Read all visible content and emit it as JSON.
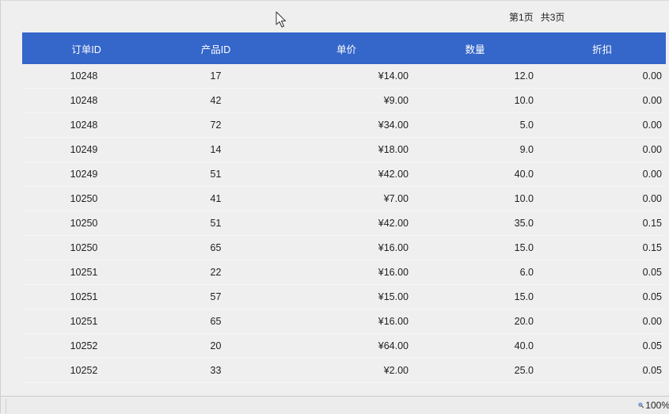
{
  "pagination": {
    "current": "第1页",
    "total": "共3页"
  },
  "table": {
    "columns": [
      "订单ID",
      "产品ID",
      "单价",
      "数量",
      "折扣"
    ],
    "rows": [
      [
        "10248",
        "17",
        "¥14.00",
        "12.0",
        "0.00"
      ],
      [
        "10248",
        "42",
        "¥9.00",
        "10.0",
        "0.00"
      ],
      [
        "10248",
        "72",
        "¥34.00",
        "5.0",
        "0.00"
      ],
      [
        "10249",
        "14",
        "¥18.00",
        "9.0",
        "0.00"
      ],
      [
        "10249",
        "51",
        "¥42.00",
        "40.0",
        "0.00"
      ],
      [
        "10250",
        "41",
        "¥7.00",
        "10.0",
        "0.00"
      ],
      [
        "10250",
        "51",
        "¥42.00",
        "35.0",
        "0.15"
      ],
      [
        "10250",
        "65",
        "¥16.00",
        "15.0",
        "0.15"
      ],
      [
        "10251",
        "22",
        "¥16.00",
        "6.0",
        "0.05"
      ],
      [
        "10251",
        "57",
        "¥15.00",
        "15.0",
        "0.05"
      ],
      [
        "10251",
        "65",
        "¥16.00",
        "20.0",
        "0.00"
      ],
      [
        "10252",
        "20",
        "¥64.00",
        "40.0",
        "0.05"
      ],
      [
        "10252",
        "33",
        "¥2.00",
        "25.0",
        "0.05"
      ]
    ]
  },
  "status_bar": {
    "zoom": "100%",
    "zoom_icon": "magnifier-icon"
  },
  "colors": {
    "header_bg": "#3566c9",
    "header_text": "#ffffff",
    "page_bg": "#efefef"
  }
}
